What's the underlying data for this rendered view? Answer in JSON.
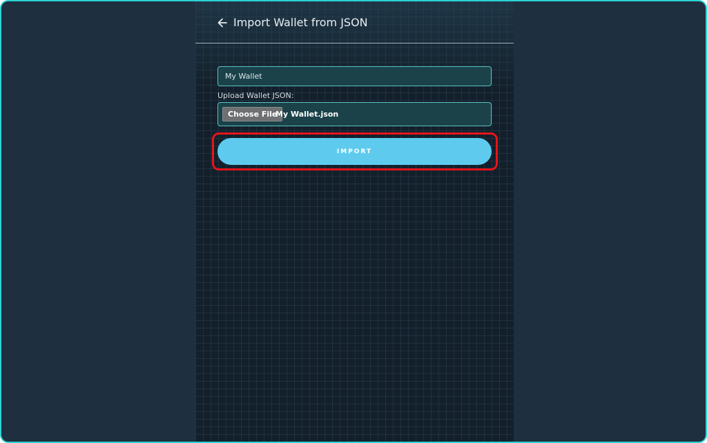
{
  "header": {
    "back_icon": "arrow-left-icon",
    "title": "Import Wallet from JSON"
  },
  "form": {
    "wallet_name_value": "My Wallet",
    "upload_label": "Upload Wallet JSON:",
    "choose_file_label": "Choose File",
    "selected_file": "My Wallet.json",
    "import_label": "IMPORT"
  },
  "colors": {
    "accent": "#5ecbee",
    "input_bg": "#1b4249",
    "input_border": "#5bc4c8",
    "highlight": "#e8141a"
  }
}
